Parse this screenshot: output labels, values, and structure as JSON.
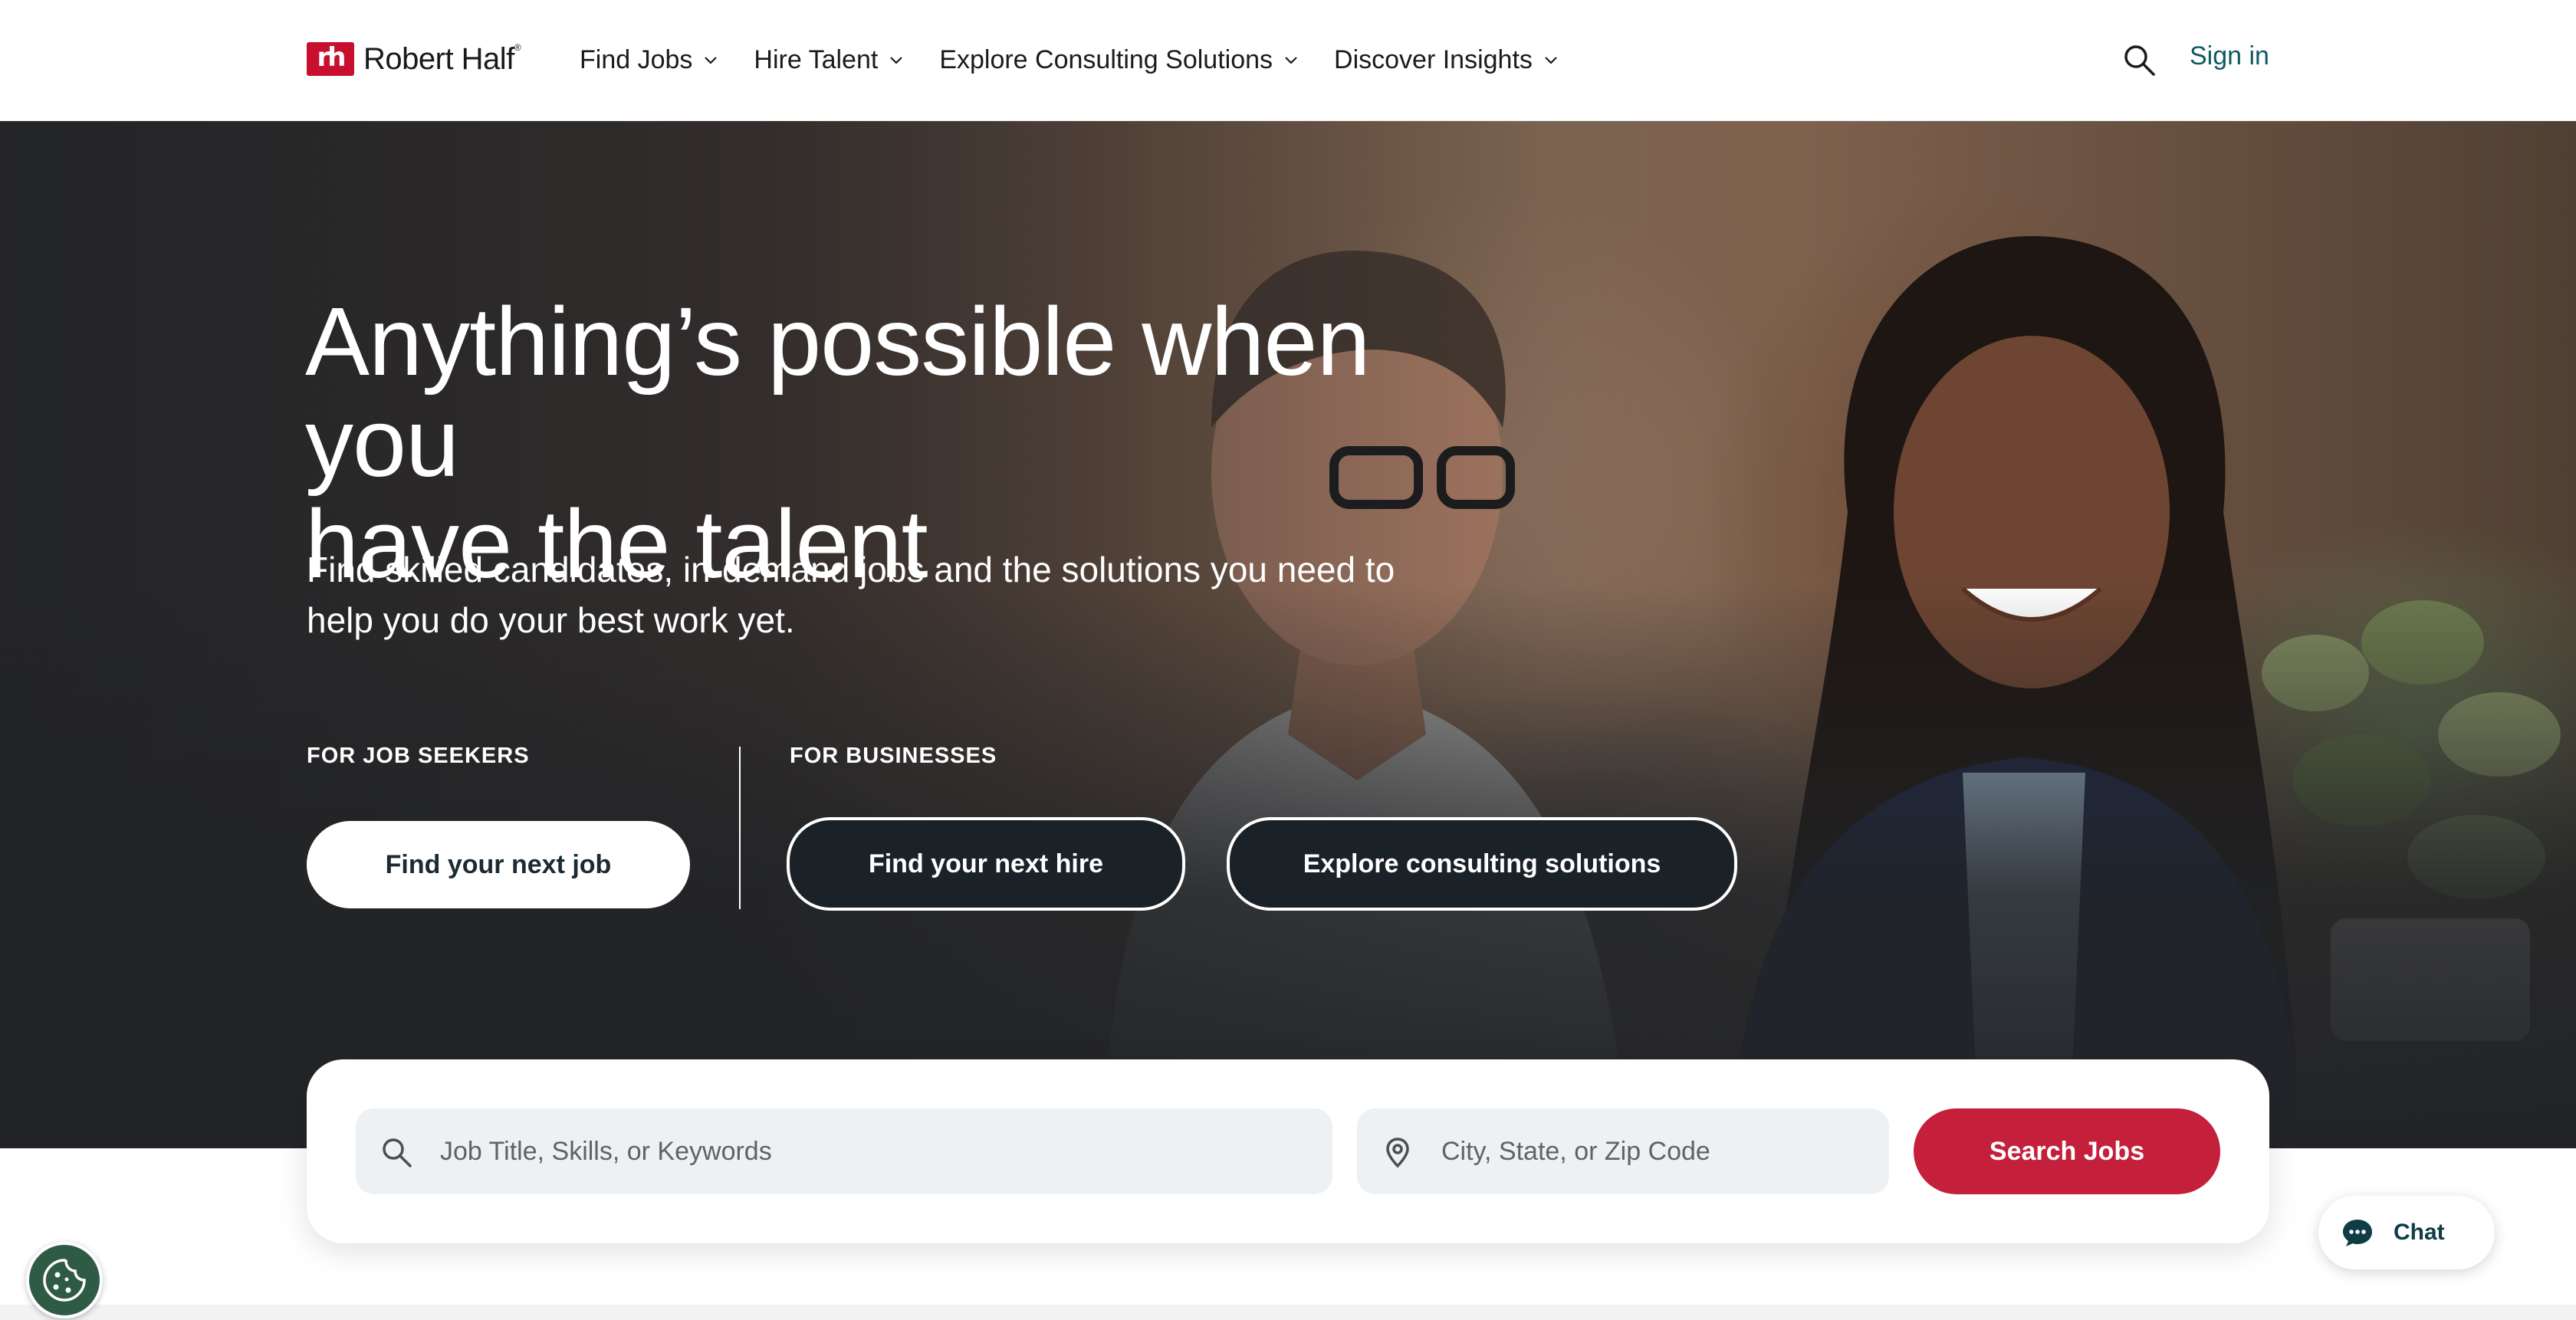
{
  "header": {
    "logo_mark": "rh",
    "logo_text": "Robert Half",
    "nav": [
      {
        "label": "Find Jobs"
      },
      {
        "label": "Hire Talent"
      },
      {
        "label": "Explore Consulting Solutions"
      },
      {
        "label": "Discover Insights"
      }
    ],
    "signin_label": "Sign in"
  },
  "hero": {
    "title_line1": "Anything’s possible when you",
    "title_line2": "have the talent",
    "subtitle_line1": "Find skilled candidates, in-demand jobs and the solutions you need to",
    "subtitle_line2": "help you do your best work yet.",
    "job_seekers_label": "FOR JOB SEEKERS",
    "businesses_label": "FOR BUSINESSES",
    "find_job_button": "Find your next job",
    "find_hire_button": "Find your next hire",
    "consulting_button": "Explore consulting solutions"
  },
  "search": {
    "keywords_placeholder": "Job Title, Skills, or Keywords",
    "location_placeholder": "City, State, or Zip Code",
    "submit_label": "Search Jobs"
  },
  "chat": {
    "label": "Chat"
  },
  "colors": {
    "brand_red": "#c8102e",
    "button_red": "#c41f3b",
    "link_teal": "#0e5a62",
    "cookie_green": "#2f5a44",
    "hero_dark": "#222428"
  },
  "icons": [
    "search-icon",
    "chevron-down-icon",
    "map-pin-icon",
    "chat-bubble-icon",
    "cookie-icon"
  ]
}
